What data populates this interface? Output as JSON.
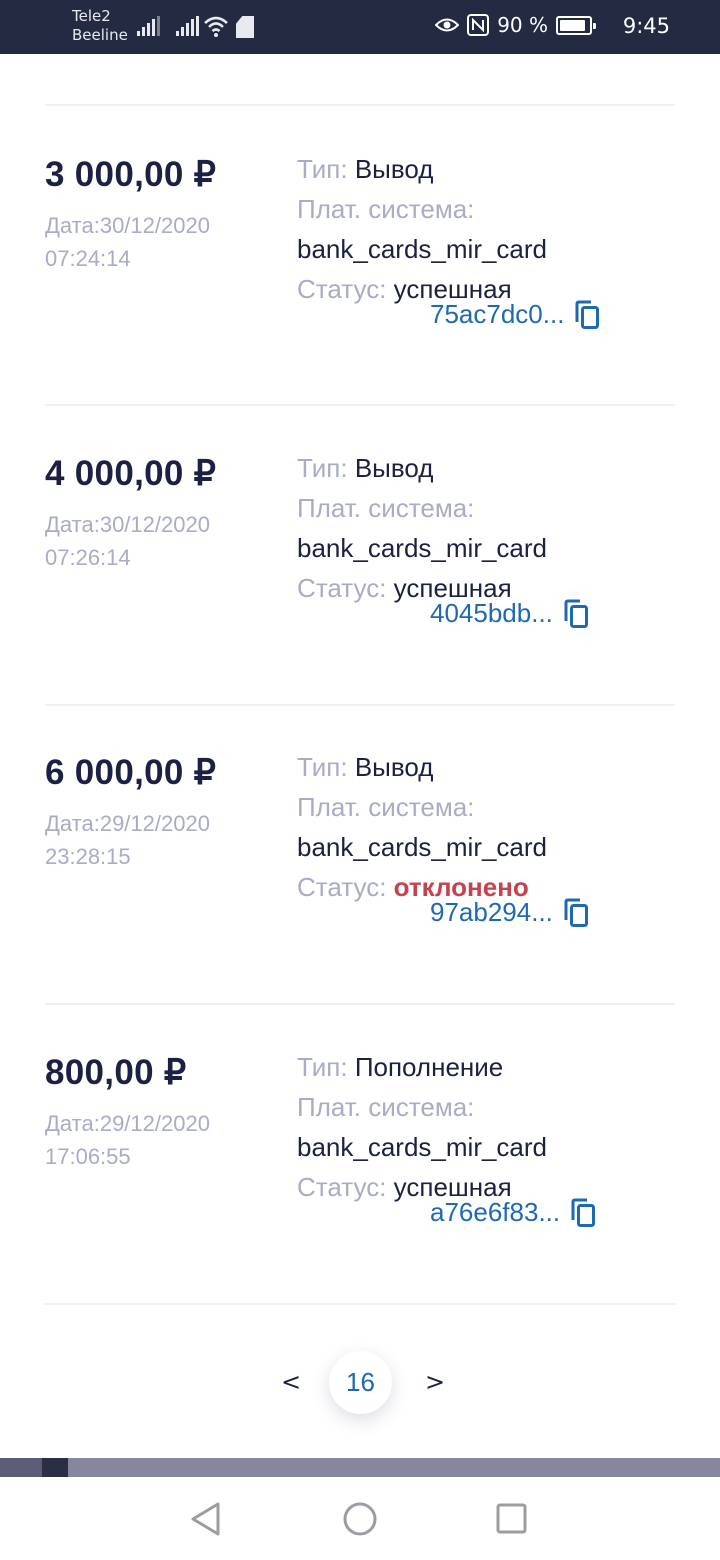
{
  "status_bar": {
    "carrier1": "Tele2",
    "carrier2": "Beeline",
    "battery_percent": "90 %",
    "battery_level": 0.9,
    "time": "9:45"
  },
  "labels": {
    "type": "Тип:",
    "pay_system": "Плат. система:",
    "status": "Статус:"
  },
  "transactions": [
    {
      "amount": "3 000,00 ₽",
      "date": "Дата:30/12/2020",
      "time": "07:24:14",
      "type": "Вывод",
      "pay_system": "bank_cards_mir_card",
      "status": "успешная",
      "status_kind": "success",
      "hash": "75ac7dc0..."
    },
    {
      "amount": "4 000,00 ₽",
      "date": "Дата:30/12/2020",
      "time": "07:26:14",
      "type": "Вывод",
      "pay_system": "bank_cards_mir_card",
      "status": "успешная",
      "status_kind": "success",
      "hash": "4045bdb..."
    },
    {
      "amount": "6 000,00 ₽",
      "date": "Дата:29/12/2020",
      "time": "23:28:15",
      "type": "Вывод",
      "pay_system": "bank_cards_mir_card",
      "status": "отклонено",
      "status_kind": "rejected",
      "hash": "97ab294..."
    },
    {
      "amount": "800,00 ₽",
      "date": "Дата:29/12/2020",
      "time": "17:06:55",
      "type": "Пополнение",
      "pay_system": "bank_cards_mir_card",
      "status": "успешная",
      "status_kind": "success",
      "hash": "a76e6f83..."
    }
  ],
  "pagination": {
    "prev": "<",
    "current": "16",
    "next": ">"
  },
  "colors": {
    "status_bar_bg": "#232a42",
    "label": "#a9acc4",
    "text": "#1c2143",
    "link": "#1f69b3",
    "rejected": "#c8414f"
  },
  "icons": {
    "copy": "copy-icon",
    "nav_back": "back-icon",
    "nav_home": "home-icon",
    "nav_recents": "recents-icon"
  }
}
